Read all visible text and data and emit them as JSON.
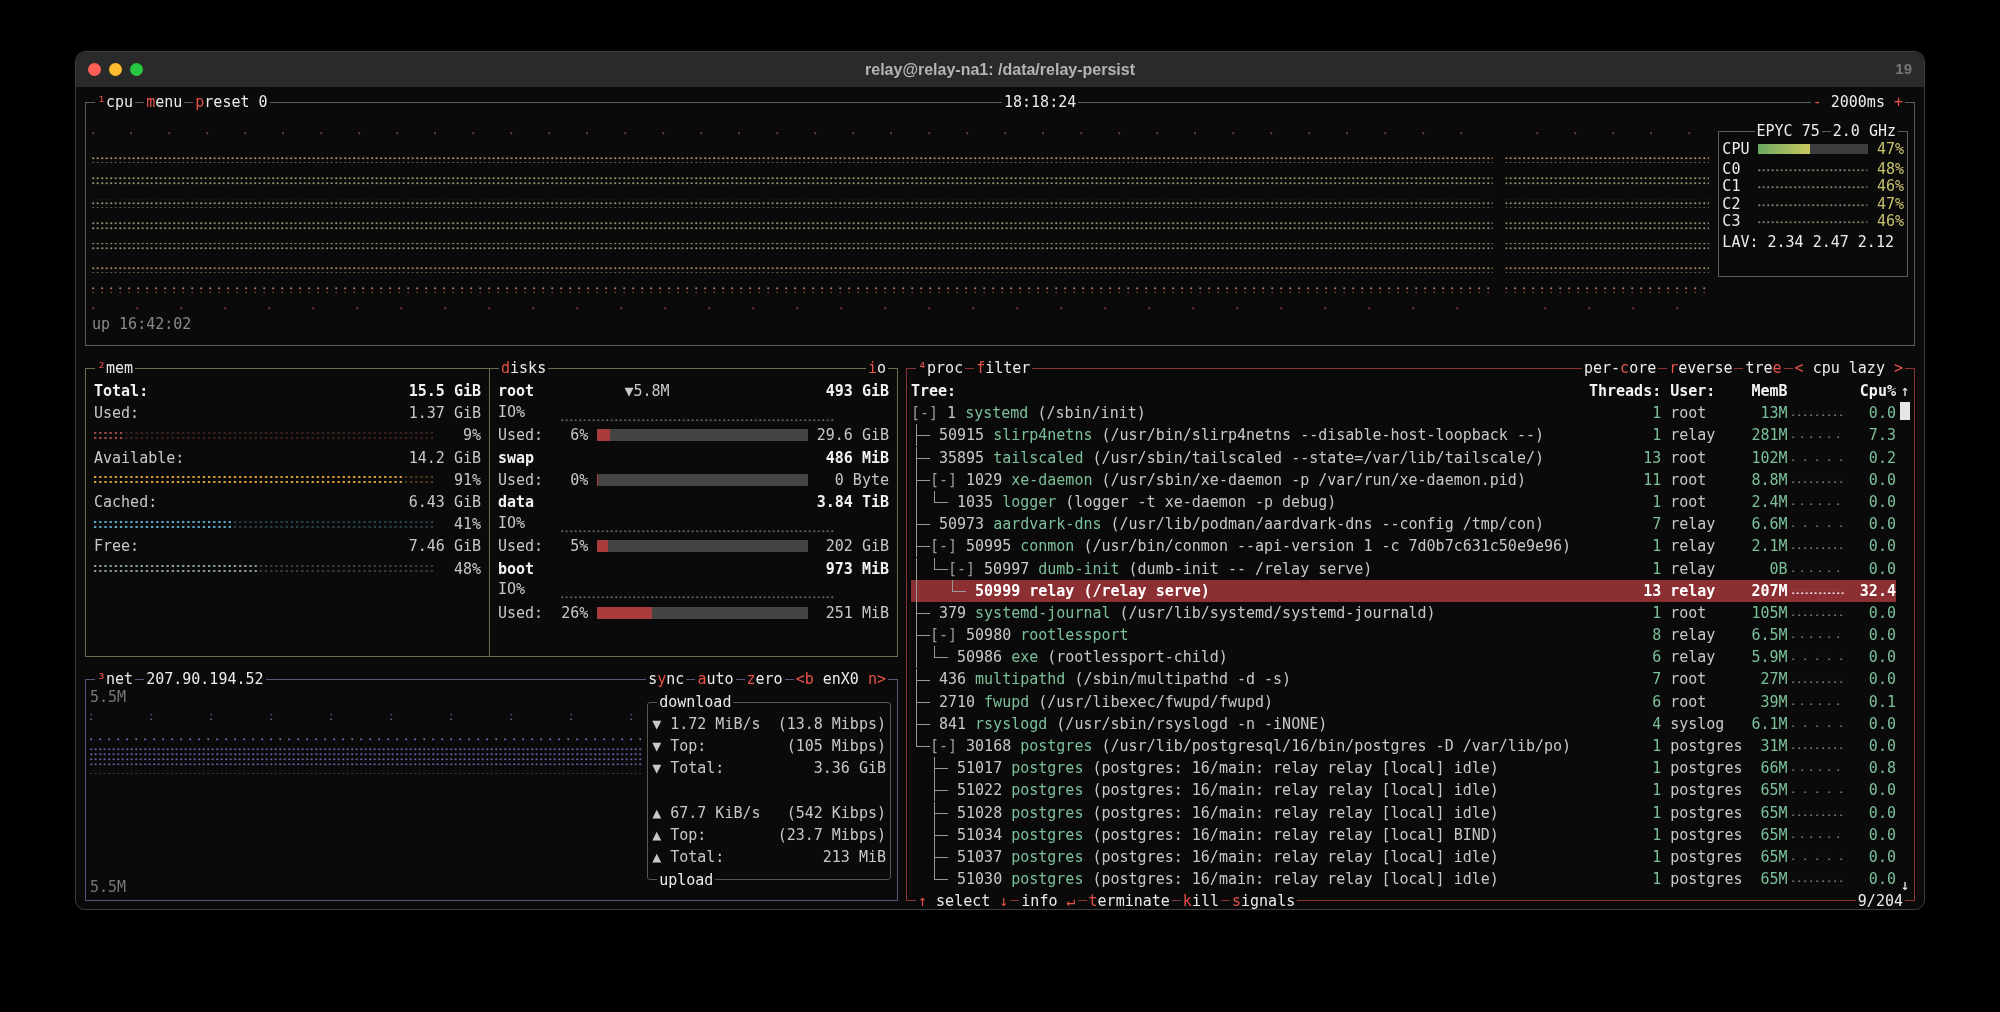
{
  "window": {
    "title": "relay@relay-na1: /data/relay-persist",
    "badge": "19"
  },
  "cpu": {
    "title": [
      [
        "¹",
        true
      ],
      [
        "cpu",
        false
      ]
    ],
    "buttons": [
      [
        [
          "m",
          true
        ],
        [
          "enu",
          false
        ]
      ],
      [
        [
          "p",
          true
        ],
        [
          "reset 0",
          false
        ]
      ]
    ],
    "clock": "18:18:24",
    "interval": [
      [
        "- ",
        true
      ],
      [
        "2000ms",
        false
      ],
      [
        " +",
        true
      ]
    ],
    "uptime": "up 16:42:02",
    "model": "EPYC 75",
    "freq": "2.0 GHz",
    "total": {
      "label": "CPU",
      "level": 0.47,
      "percent": "47%"
    },
    "cores": [
      {
        "label": "C0",
        "percent": "48%"
      },
      {
        "label": "C1",
        "percent": "46%"
      },
      {
        "label": "C2",
        "percent": "47%"
      },
      {
        "label": "C3",
        "percent": "46%"
      }
    ],
    "load": "LAV: 2.34 2.47 2.12"
  },
  "mem": {
    "title": [
      [
        "²",
        true
      ],
      [
        "mem",
        false
      ]
    ],
    "total": {
      "label": "Total:",
      "value": "15.5 GiB"
    },
    "meters": [
      {
        "label": "Used:",
        "value": "1.37 GiB",
        "level": 0.09,
        "percent": "9%",
        "color": "#a04848"
      },
      {
        "label": "Available:",
        "value": "14.2 GiB",
        "level": 0.91,
        "percent": "91%",
        "color": "#d9a032"
      },
      {
        "label": "Cached:",
        "value": "6.43 GiB",
        "level": 0.41,
        "percent": "41%",
        "color": "#5aa8c8"
      },
      {
        "label": "Free:",
        "value": "7.46 GiB",
        "level": 0.48,
        "percent": "48%",
        "color": "#88a088"
      }
    ]
  },
  "disks": {
    "title": [
      [
        "d",
        true
      ],
      [
        "isks",
        false
      ]
    ],
    "io_button": [
      [
        "i",
        true
      ],
      [
        "o",
        false
      ]
    ],
    "items": [
      {
        "name": "root",
        "rate": "▼5.8M",
        "total": "493 GiB",
        "io_label": "IO%",
        "used_label": "Used:",
        "percent": "6%",
        "level": 0.06,
        "used": "29.6 GiB"
      },
      {
        "name": "swap",
        "total": "486 MiB",
        "used_label": "Used:",
        "percent": "0%",
        "level": 0,
        "used": "0 Byte"
      },
      {
        "name": "data",
        "total": "3.84 TiB",
        "io_label": "IO%",
        "used_label": "Used:",
        "percent": "5%",
        "level": 0.05,
        "used": "202 GiB"
      },
      {
        "name": "boot",
        "total": "973 MiB",
        "io_label": "IO%",
        "used_label": "Used:",
        "percent": "26%",
        "level": 0.26,
        "used": "251 MiB"
      }
    ]
  },
  "net": {
    "title": [
      [
        "³",
        true
      ],
      [
        "net",
        false
      ]
    ],
    "address": "207.90.194.52",
    "buttons": [
      [
        [
          "s",
          false
        ],
        [
          "y",
          true
        ],
        [
          "nc",
          false
        ]
      ],
      [
        [
          "a",
          true
        ],
        [
          "uto",
          false
        ]
      ],
      [
        [
          "z",
          true
        ],
        [
          "ero",
          false
        ]
      ]
    ],
    "interface": [
      [
        "<b",
        true
      ],
      [
        " enX0 ",
        false
      ],
      [
        "n>",
        true
      ]
    ],
    "scale_top": "5.5M",
    "scale_bottom": "5.5M",
    "download": {
      "title": "download",
      "rows": [
        {
          "arrow": "▼",
          "label": "1.72 MiB/s",
          "value": "(13.8 Mibps)"
        },
        {
          "arrow": "▼",
          "label": "Top:",
          "value": "(105 Mibps)"
        },
        {
          "arrow": "▼",
          "label": "Total:",
          "value": "3.36 GiB"
        }
      ]
    },
    "upload": {
      "title": "upload",
      "rows": [
        {
          "arrow": "▲",
          "label": "67.7 KiB/s",
          "value": "(542 Kibps)"
        },
        {
          "arrow": "▲",
          "label": "Top:",
          "value": "(23.7 Mibps)"
        },
        {
          "arrow": "▲",
          "label": "Total:",
          "value": "213 MiB"
        }
      ]
    }
  },
  "proc": {
    "title": [
      [
        "⁴",
        true
      ],
      [
        "proc",
        false
      ]
    ],
    "filter": [
      [
        "f",
        true
      ],
      [
        "ilter",
        false
      ]
    ],
    "options": [
      [
        [
          "per-",
          false
        ],
        [
          "c",
          true
        ],
        [
          "ore",
          false
        ]
      ],
      [
        [
          "r",
          true
        ],
        [
          "everse",
          false
        ]
      ],
      [
        [
          "tre",
          false
        ],
        [
          "e",
          true
        ]
      ]
    ],
    "sort": [
      [
        "< ",
        true
      ],
      [
        "cpu lazy",
        false
      ],
      [
        " >",
        true
      ]
    ],
    "columns": [
      "Tree:",
      "Threads:",
      "User:",
      "MemB",
      "Cpu%"
    ],
    "scroll_up": "↑",
    "scroll_down": "↓",
    "processes": [
      {
        "toggle": "[-]",
        "pid": "1",
        "name": "systemd",
        "args": "(/sbin/init)",
        "threads": "1",
        "user": "root",
        "mem": "13M",
        "cpu": "0.0",
        "selected": false,
        "children": [
          {
            "pid": "50915",
            "name": "slirp4netns",
            "args": "(/usr/bin/slirp4netns --disable-host-loopback --)",
            "threads": "1",
            "user": "relay",
            "mem": "281M",
            "cpu": "7.3",
            "selected": false
          },
          {
            "pid": "35895",
            "name": "tailscaled",
            "args": "(/usr/sbin/tailscaled --state=/var/lib/tailscale/)",
            "threads": "13",
            "user": "root",
            "mem": "102M",
            "cpu": "0.2",
            "selected": false
          },
          {
            "toggle": "[-]",
            "pid": "1029",
            "name": "xe-daemon",
            "args": "(/usr/sbin/xe-daemon -p /var/run/xe-daemon.pid)",
            "threads": "11",
            "user": "root",
            "mem": "8.8M",
            "cpu": "0.0",
            "selected": false,
            "children": [
              {
                "pid": "1035",
                "name": "logger",
                "args": "(logger -t xe-daemon -p debug)",
                "threads": "1",
                "user": "root",
                "mem": "2.4M",
                "cpu": "0.0",
                "selected": false
              }
            ]
          },
          {
            "pid": "50973",
            "name": "aardvark-dns",
            "args": "(/usr/lib/podman/aardvark-dns --config /tmp/con)",
            "threads": "7",
            "user": "relay",
            "mem": "6.6M",
            "cpu": "0.0",
            "selected": false
          },
          {
            "toggle": "[-]",
            "pid": "50995",
            "name": "conmon",
            "args": "(/usr/bin/conmon --api-version 1 -c 7d0b7c631c50e9e96)",
            "threads": "1",
            "user": "relay",
            "mem": "2.1M",
            "cpu": "0.0",
            "selected": false,
            "children": [
              {
                "toggle": "[-]",
                "pid": "50997",
                "name": "dumb-init",
                "args": "(dumb-init -- /relay serve)",
                "threads": "1",
                "user": "relay",
                "mem": "0B",
                "cpu": "0.0",
                "selected": false,
                "children": [
                  {
                    "pid": "50999",
                    "name": "relay",
                    "args": "(/relay serve)",
                    "threads": "13",
                    "user": "relay",
                    "mem": "207M",
                    "cpu": "32.4",
                    "selected": true
                  }
                ]
              }
            ]
          },
          {
            "pid": "379",
            "name": "systemd-journal",
            "args": "(/usr/lib/systemd/systemd-journald)",
            "threads": "1",
            "user": "root",
            "mem": "105M",
            "cpu": "0.0",
            "selected": false
          },
          {
            "toggle": "[-]",
            "pid": "50980",
            "name": "rootlessport",
            "threads": "8",
            "user": "relay",
            "mem": "6.5M",
            "cpu": "0.0",
            "selected": false,
            "children": [
              {
                "pid": "50986",
                "name": "exe",
                "args": "(rootlessport-child)",
                "threads": "6",
                "user": "relay",
                "mem": "5.9M",
                "cpu": "0.0",
                "selected": false
              }
            ]
          },
          {
            "pid": "436",
            "name": "multipathd",
            "args": "(/sbin/multipathd -d -s)",
            "threads": "7",
            "user": "root",
            "mem": "27M",
            "cpu": "0.0",
            "selected": false
          },
          {
            "pid": "2710",
            "name": "fwupd",
            "args": "(/usr/libexec/fwupd/fwupd)",
            "threads": "6",
            "user": "root",
            "mem": "39M",
            "cpu": "0.1",
            "selected": false
          },
          {
            "pid": "841",
            "name": "rsyslogd",
            "args": "(/usr/sbin/rsyslogd -n -iNONE)",
            "threads": "4",
            "user": "syslog",
            "mem": "6.1M",
            "cpu": "0.0",
            "selected": false
          },
          {
            "toggle": "[-]",
            "pid": "30168",
            "name": "postgres",
            "args": "(/usr/lib/postgresql/16/bin/postgres -D /var/lib/po)",
            "threads": "1",
            "user": "postgres",
            "mem": "31M",
            "cpu": "0.0",
            "selected": false,
            "children": [
              {
                "pid": "51017",
                "name": "postgres",
                "args": "(postgres: 16/main: relay relay [local] idle)",
                "threads": "1",
                "user": "postgres",
                "mem": "66M",
                "cpu": "0.8",
                "selected": false
              },
              {
                "pid": "51022",
                "name": "postgres",
                "args": "(postgres: 16/main: relay relay [local] idle)",
                "threads": "1",
                "user": "postgres",
                "mem": "65M",
                "cpu": "0.0",
                "selected": false
              },
              {
                "pid": "51028",
                "name": "postgres",
                "args": "(postgres: 16/main: relay relay [local] idle)",
                "threads": "1",
                "user": "postgres",
                "mem": "65M",
                "cpu": "0.0",
                "selected": false
              },
              {
                "pid": "51034",
                "name": "postgres",
                "args": "(postgres: 16/main: relay relay [local] BIND)",
                "threads": "1",
                "user": "postgres",
                "mem": "65M",
                "cpu": "0.0",
                "selected": false
              },
              {
                "pid": "51037",
                "name": "postgres",
                "args": "(postgres: 16/main: relay relay [local] idle)",
                "threads": "1",
                "user": "postgres",
                "mem": "65M",
                "cpu": "0.0",
                "selected": false
              },
              {
                "pid": "51030",
                "name": "postgres",
                "args": "(postgres: 16/main: relay relay [local] idle)",
                "threads": "1",
                "user": "postgres",
                "mem": "65M",
                "cpu": "0.0",
                "selected": false
              }
            ]
          }
        ]
      }
    ],
    "footer": [
      [
        [
          "↑",
          true
        ],
        [
          " select ",
          false
        ],
        [
          "↓",
          true
        ]
      ],
      [
        [
          "info ",
          false
        ],
        [
          "↵",
          true
        ]
      ],
      [
        [
          "t",
          true
        ],
        [
          "erminate",
          false
        ]
      ],
      [
        [
          "k",
          true
        ],
        [
          "ill",
          false
        ]
      ],
      [
        [
          "s",
          true
        ],
        [
          "ignals",
          false
        ]
      ]
    ],
    "count": "9/204"
  }
}
